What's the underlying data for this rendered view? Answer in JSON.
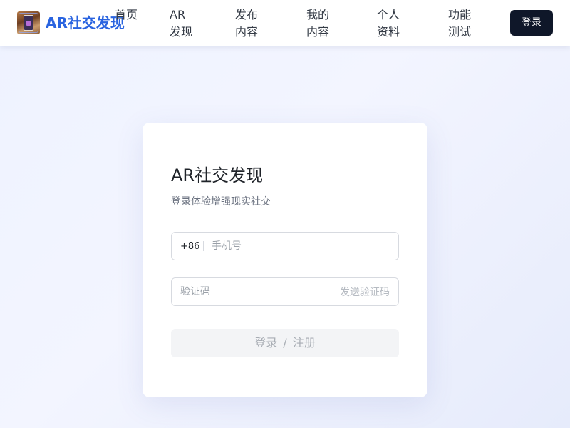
{
  "header": {
    "brand": "AR社交发现",
    "nav": [
      {
        "label": "首页"
      },
      {
        "label": "AR 发现"
      },
      {
        "label": "发布内容"
      },
      {
        "label": "我的内容"
      },
      {
        "label": "个人资料"
      },
      {
        "label": "功能测试"
      }
    ],
    "login_label": "登录"
  },
  "login_card": {
    "title": "AR社交发现",
    "subtitle": "登录体验增强现实社交",
    "phone": {
      "prefix": "+86",
      "placeholder": "手机号",
      "value": ""
    },
    "code": {
      "placeholder": "验证码",
      "value": "",
      "send_label": "发送验证码"
    },
    "submit": {
      "login": "登录",
      "separator": "/",
      "register": "注册"
    }
  },
  "colors": {
    "brand": "#2a64e0",
    "primary_button": "#0f1729",
    "background": "#eef2ff"
  }
}
